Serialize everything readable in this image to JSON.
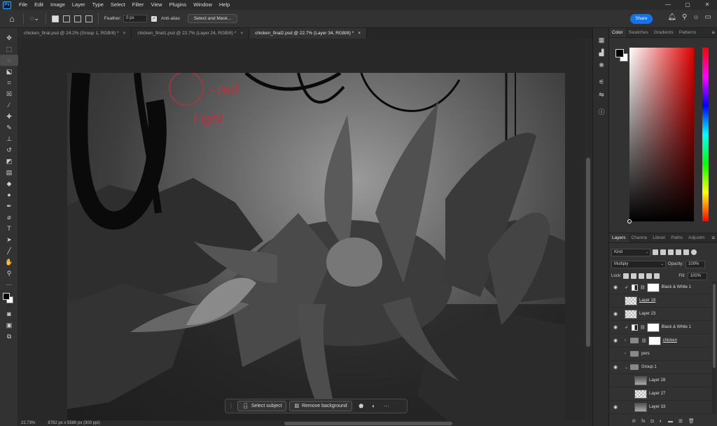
{
  "menubar": {
    "logo": "Ps",
    "items": [
      "File",
      "Edit",
      "Image",
      "Layer",
      "Type",
      "Select",
      "Filter",
      "View",
      "Plugins",
      "Window",
      "Help"
    ],
    "controls": [
      "—",
      "▢",
      "✕"
    ]
  },
  "options": {
    "feather_label": "Feather:",
    "feather_value": "0 px",
    "antialias_label": "Anti-alias",
    "select_mask_label": "Select and Mask...",
    "share_label": "Share"
  },
  "tabs": [
    {
      "label": "chicken_final.psd @ 24.2% (Group 1, RGB/8) *",
      "active": false
    },
    {
      "label": "chicken_final1.psd @ 22.7% (Layer 24, RGB/8) *",
      "active": false
    },
    {
      "label": "chicken_final2.psd @ 22.7% (Layer 34, RGB/8) *",
      "active": true
    }
  ],
  "canvas": {
    "annotation_text_1": "- red",
    "annotation_text_2": "l ight",
    "annotation_color": "#c0303a"
  },
  "status": {
    "zoom": "22.73%",
    "doc_size": "8782 px x 5580 px (300 ppi)"
  },
  "contextual_bar": {
    "select_subject": "Select subject",
    "remove_background": "Remove background"
  },
  "color_panel": {
    "tabs": [
      "Color",
      "Swatches",
      "Gradients",
      "Patterns"
    ],
    "foreground": "#000000",
    "background": "#ffffff",
    "hue_color": "#e00000"
  },
  "layers_panel": {
    "tabs": [
      "Layers",
      "Channe",
      "Librari",
      "Paths",
      "Adjustm"
    ],
    "filter_kind": "Kind",
    "blend_mode": "Multiply",
    "opacity_label": "Opacity:",
    "opacity_value": "100%",
    "lock_label": "Lock:",
    "fill_label": "Fill:",
    "fill_value": "100%",
    "layers": [
      {
        "name": "Black & White 1",
        "type": "adjustment",
        "visible": true,
        "indent": 0,
        "underline": false
      },
      {
        "name": "Layer 18",
        "type": "transparent",
        "visible": false,
        "indent": 0,
        "underline": true
      },
      {
        "name": "Layer 23",
        "type": "transparent",
        "visible": true,
        "indent": 0,
        "underline": false
      },
      {
        "name": "Black & White 1",
        "type": "adjustment",
        "visible": true,
        "indent": 0,
        "underline": false
      },
      {
        "name": "chicken",
        "type": "group-mask",
        "visible": true,
        "indent": 0,
        "underline": true
      },
      {
        "name": "pers",
        "type": "group",
        "visible": false,
        "indent": 0,
        "underline": false
      },
      {
        "name": "Group 1",
        "type": "group-open",
        "visible": true,
        "indent": 0,
        "underline": false
      },
      {
        "name": "Layer 28",
        "type": "image",
        "visible": false,
        "indent": 1,
        "underline": false
      },
      {
        "name": "Layer 27",
        "type": "transparent",
        "visible": false,
        "indent": 1,
        "underline": false
      },
      {
        "name": "Layer 33",
        "type": "image",
        "visible": true,
        "indent": 1,
        "underline": false
      }
    ]
  }
}
